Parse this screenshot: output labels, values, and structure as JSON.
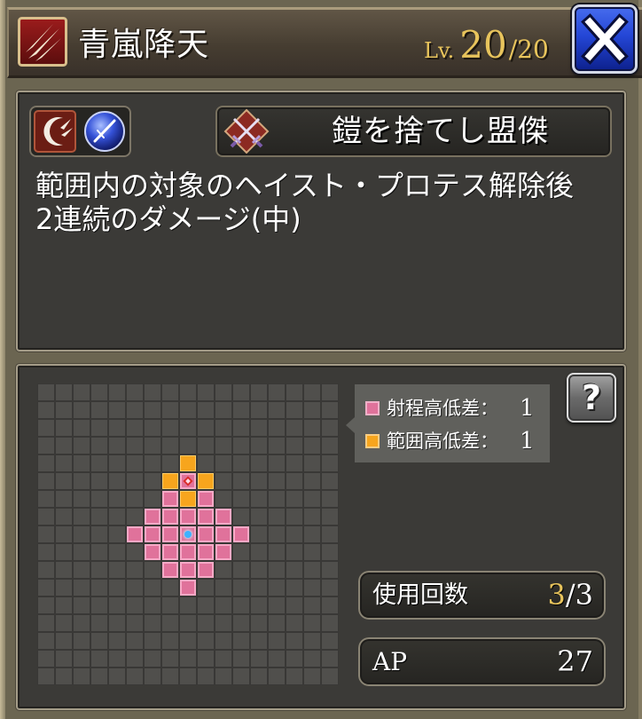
{
  "header": {
    "ability_icon": "claw-slash-icon",
    "title": "青嵐降天",
    "level_label": "Lv.",
    "level_current": "20",
    "level_max": "/20",
    "close_icon": "close-icon"
  },
  "skill": {
    "type_icons": [
      "claw-crescent-icon",
      "blue-orb-slash-icon"
    ],
    "source_icon": "crossed-swords-icon",
    "source_name": "鎧を捨てし盟傑",
    "description": [
      "範囲内の対象のヘイスト・プロテス解除後",
      "2連続のダメージ(中)"
    ]
  },
  "range_map": {
    "caster_tile": [
      0,
      0
    ],
    "target_tile": [
      0,
      -3
    ],
    "range_tiles": [
      [
        0,
        -3
      ],
      [
        -1,
        -2
      ],
      [
        0,
        -2
      ],
      [
        1,
        -2
      ],
      [
        -2,
        -1
      ],
      [
        -1,
        -1
      ],
      [
        0,
        -1
      ],
      [
        1,
        -1
      ],
      [
        2,
        -1
      ],
      [
        -3,
        0
      ],
      [
        -2,
        0
      ],
      [
        -1,
        0
      ],
      [
        0,
        0
      ],
      [
        1,
        0
      ],
      [
        2,
        0
      ],
      [
        3,
        0
      ],
      [
        -2,
        1
      ],
      [
        -1,
        1
      ],
      [
        0,
        1
      ],
      [
        1,
        1
      ],
      [
        2,
        1
      ],
      [
        -1,
        2
      ],
      [
        0,
        2
      ],
      [
        1,
        2
      ],
      [
        0,
        3
      ]
    ],
    "area_tiles": [
      [
        0,
        -4
      ],
      [
        -1,
        -3
      ],
      [
        1,
        -3
      ],
      [
        0,
        -2
      ]
    ]
  },
  "legend": [
    {
      "label": "射程高低差：",
      "value": "1",
      "color": "#e0729b"
    },
    {
      "label": "範囲高低差：",
      "value": "1",
      "color": "#f7a51d"
    }
  ],
  "help_button": {
    "label": "?",
    "icon": "help-icon"
  },
  "stats": {
    "uses_label": "使用回数",
    "uses_current": "3",
    "uses_max": "/3",
    "ap_label": "AP",
    "ap_value": "27"
  },
  "colors": {
    "accent_gold": "#e8c45c",
    "range": "#e0729b",
    "area": "#f7a51d",
    "caster_marker": "#3eb2ff",
    "target_marker": "#d92a2a"
  }
}
